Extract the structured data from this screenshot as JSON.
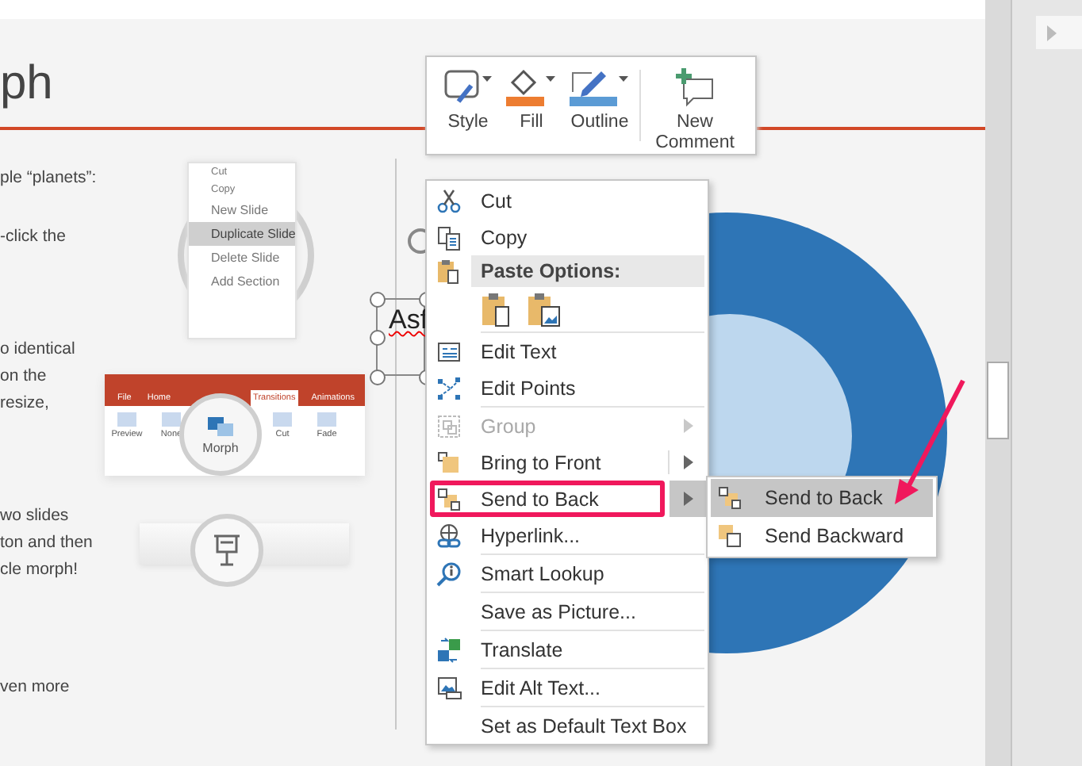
{
  "slide": {
    "title": "ph",
    "paragraphs": [
      [
        "ple “planets”:"
      ],
      [
        "-click the"
      ],
      [
        "o identical",
        "on the",
        "resize,"
      ],
      [
        "wo slides",
        "ton and then",
        "cle morph!"
      ],
      [
        "ven more"
      ]
    ],
    "thumbnail_menu": {
      "items": [
        {
          "label": "Cut",
          "selected": false
        },
        {
          "label": "Copy",
          "selected": false
        },
        {
          "label": "New Slide",
          "selected": false
        },
        {
          "label": "Duplicate Slide",
          "selected": true
        },
        {
          "label": "Delete Slide",
          "selected": false
        },
        {
          "label": "Add Section",
          "selected": false
        }
      ]
    },
    "thumbnail_ribbon": {
      "tabs": [
        {
          "label": "File",
          "selected": false
        },
        {
          "label": "Home",
          "selected": false
        },
        {
          "label": "Transitions",
          "selected": true
        },
        {
          "label": "Animations",
          "selected": false
        }
      ],
      "buttons": [
        {
          "label": "Preview"
        },
        {
          "label": "None"
        },
        {
          "label": "Morph"
        },
        {
          "label": "Cut"
        },
        {
          "label": "Fade"
        }
      ]
    },
    "text_box": {
      "text": "Asf",
      "spelling_error": true
    }
  },
  "mini_toolbar": {
    "buttons": [
      {
        "label": "Style",
        "dropdown": true
      },
      {
        "label": "Fill",
        "dropdown": true
      },
      {
        "label": "Outline",
        "dropdown": true
      },
      {
        "label": "New Comment",
        "dropdown": false
      }
    ]
  },
  "context_menu": {
    "items": [
      {
        "kind": "item",
        "label": "Cut",
        "disabled": false,
        "selected": false,
        "submenu": false,
        "annotated": false
      },
      {
        "kind": "item",
        "label": "Copy",
        "disabled": false,
        "selected": false,
        "submenu": false,
        "annotated": false
      },
      {
        "kind": "header",
        "label": "Paste Options:"
      },
      {
        "kind": "paste_icons"
      },
      {
        "kind": "separator"
      },
      {
        "kind": "item",
        "label": "Edit Text",
        "disabled": false,
        "selected": false,
        "submenu": false,
        "annotated": false
      },
      {
        "kind": "item",
        "label": "Edit Points",
        "disabled": false,
        "selected": false,
        "submenu": false,
        "annotated": false
      },
      {
        "kind": "separator"
      },
      {
        "kind": "item",
        "label": "Group",
        "disabled": true,
        "selected": false,
        "submenu": true,
        "annotated": false
      },
      {
        "kind": "item",
        "label": "Bring to Front",
        "disabled": false,
        "selected": false,
        "submenu": true,
        "annotated": false
      },
      {
        "kind": "item",
        "label": "Send to Back",
        "disabled": false,
        "selected": true,
        "submenu": true,
        "annotated": true
      },
      {
        "kind": "item",
        "label": "Hyperlink...",
        "disabled": false,
        "selected": false,
        "submenu": false,
        "annotated": false
      },
      {
        "kind": "separator"
      },
      {
        "kind": "item",
        "label": "Smart Lookup",
        "disabled": false,
        "selected": false,
        "submenu": false,
        "annotated": false
      },
      {
        "kind": "separator"
      },
      {
        "kind": "item",
        "label": "Save as Picture...",
        "disabled": false,
        "selected": false,
        "submenu": false,
        "annotated": false
      },
      {
        "kind": "separator"
      },
      {
        "kind": "item",
        "label": "Translate",
        "disabled": false,
        "selected": false,
        "submenu": false,
        "annotated": false
      },
      {
        "kind": "separator"
      },
      {
        "kind": "item",
        "label": "Edit Alt Text...",
        "disabled": false,
        "selected": false,
        "submenu": false,
        "annotated": false
      },
      {
        "kind": "separator"
      },
      {
        "kind": "item",
        "label": "Set as Default Text Box",
        "disabled": false,
        "selected": false,
        "submenu": false,
        "annotated": false
      }
    ]
  },
  "submenu": {
    "items": [
      {
        "label": "Send to Back",
        "selected": true
      },
      {
        "label": "Send Backward",
        "selected": false
      }
    ]
  }
}
